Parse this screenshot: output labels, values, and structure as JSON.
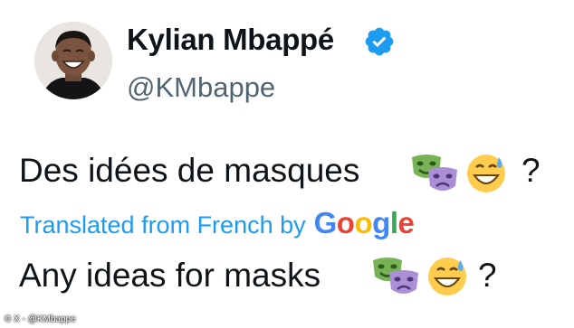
{
  "author": {
    "display_name": "Kylian Mbappé",
    "handle": "@KMbappe",
    "verified": true,
    "verified_icon": "verified-badge-icon"
  },
  "tweet": {
    "text": "Des idées de masques",
    "emoji": [
      "performing-arts-icon",
      "grinning-sweat-icon"
    ],
    "trailing": "?"
  },
  "translation": {
    "label": "Translated from French by",
    "provider": "Google",
    "text": "Any ideas for masks",
    "trailing": "?"
  },
  "image_caption": "© X - @KMbappe",
  "colors": {
    "link_blue": "#1d9bf0",
    "text": "#0f1419",
    "handle_grey": "#536471",
    "google_blue": "#4285f4",
    "google_red": "#ea4335",
    "google_yellow": "#fbbc05",
    "google_green": "#34a853"
  }
}
